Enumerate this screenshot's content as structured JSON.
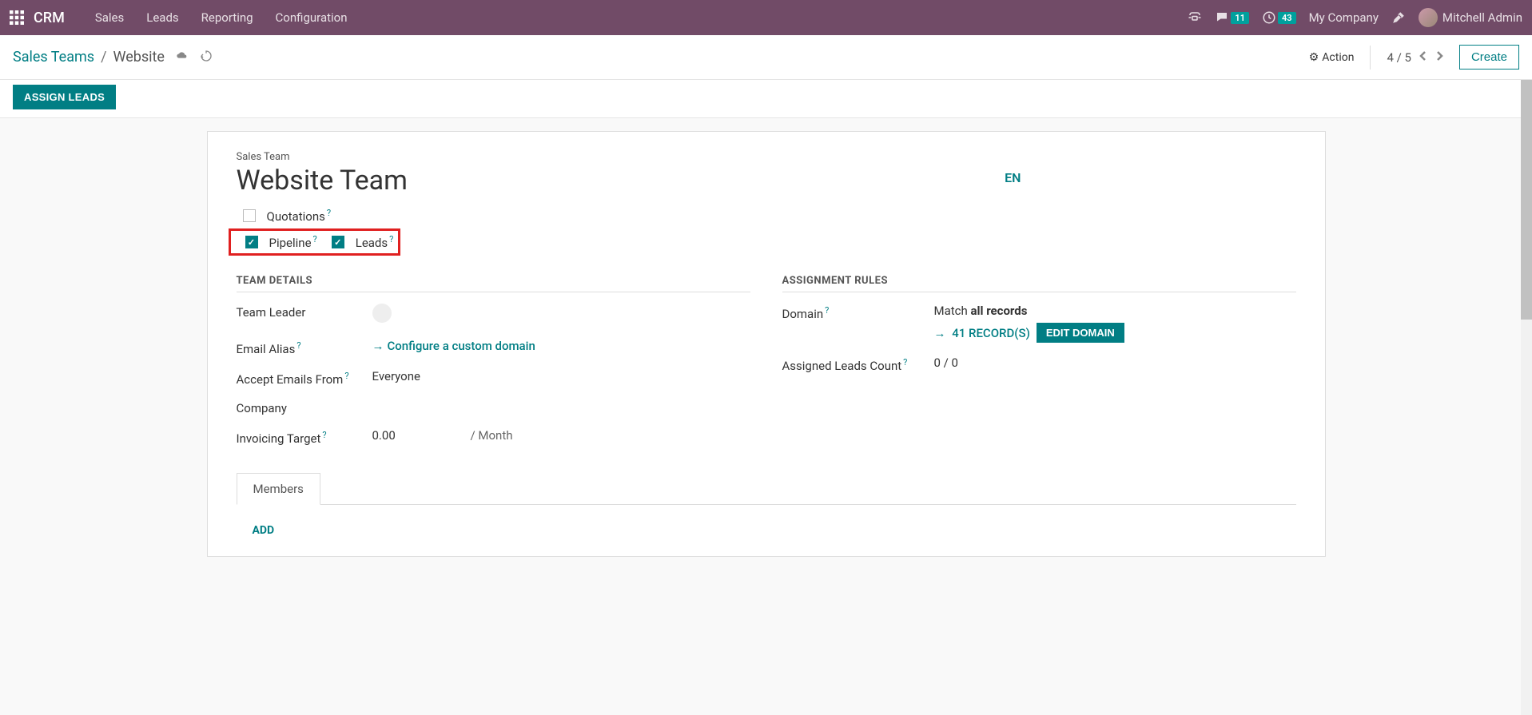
{
  "navbar": {
    "app": "CRM",
    "items": [
      "Sales",
      "Leads",
      "Reporting",
      "Configuration"
    ],
    "chat_badge": "11",
    "activity_badge": "43",
    "company": "My Company",
    "user": "Mitchell Admin"
  },
  "breadcrumb": {
    "parent": "Sales Teams",
    "current": "Website",
    "action_label": "Action",
    "pager": "4 / 5",
    "create_label": "Create"
  },
  "statusbar": {
    "assign_leads": "ASSIGN LEADS"
  },
  "form": {
    "label_sales_team": "Sales Team",
    "team_name": "Website Team",
    "lang": "EN",
    "checkboxes": {
      "quotations": {
        "label": "Quotations",
        "checked": false
      },
      "pipeline": {
        "label": "Pipeline",
        "checked": true
      },
      "leads": {
        "label": "Leads",
        "checked": true
      }
    },
    "team_details": {
      "title": "TEAM DETAILS",
      "team_leader_label": "Team Leader",
      "email_alias_label": "Email Alias",
      "configure_domain": "Configure a custom domain",
      "accept_emails_label": "Accept Emails From",
      "accept_emails_value": "Everyone",
      "company_label": "Company",
      "invoicing_target_label": "Invoicing Target",
      "invoicing_target_value": "0.00",
      "invoicing_target_suffix": "/ Month"
    },
    "assignment_rules": {
      "title": "ASSIGNMENT RULES",
      "domain_label": "Domain",
      "match_prefix": "Match ",
      "match_value": "all records",
      "records_link": "41 RECORD(S)",
      "edit_domain": "EDIT DOMAIN",
      "assigned_leads_label": "Assigned Leads Count",
      "assigned_leads_value": "0 / 0"
    },
    "tabs": {
      "members": "Members"
    },
    "add": "ADD"
  }
}
